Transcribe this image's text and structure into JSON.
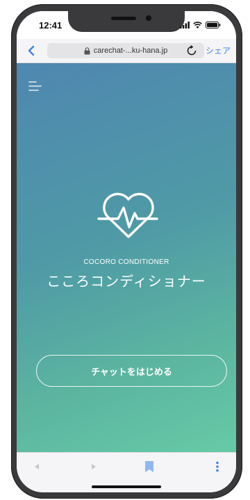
{
  "status_bar": {
    "time": "12:41"
  },
  "browser": {
    "url": "carechat-...ku-hana.jp",
    "share_label": "シェア"
  },
  "app": {
    "subtitle": "COCORO CONDITIONER",
    "title": "こころコンディショナー",
    "start_button_label": "チャットをはじめる"
  },
  "colors": {
    "gradient_top": "#4f87b0",
    "gradient_bottom": "#66caa6",
    "browser_accent": "#3b82f6"
  },
  "icons": {
    "browser_back": "chevron-left-icon",
    "lock": "lock-icon",
    "reload": "reload-icon",
    "menu": "menu-icon",
    "logo": "heart-pulse-icon",
    "toolbar_back": "triangle-left-icon",
    "toolbar_forward": "triangle-right-icon",
    "bookmark": "bookmark-icon",
    "more": "more-vertical-icon"
  }
}
